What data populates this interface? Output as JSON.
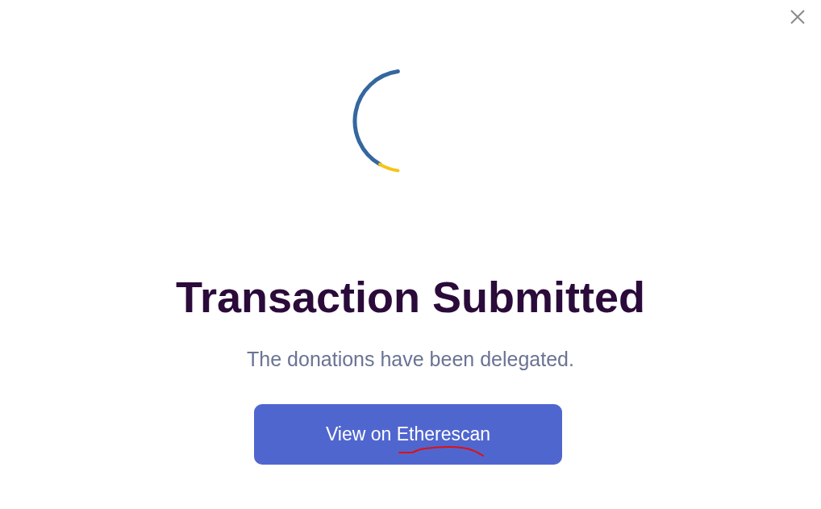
{
  "dialog": {
    "title": "Transaction Submitted",
    "message": "The donations have been delegated.",
    "button": {
      "label": "View on Etherescan"
    }
  }
}
